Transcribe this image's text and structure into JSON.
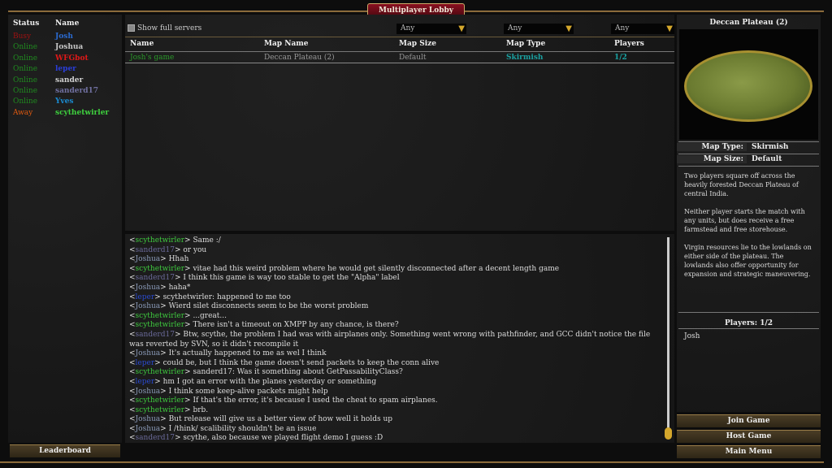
{
  "title": "Multiplayer Lobby",
  "colors": {
    "accent_gold": "#b08a50",
    "busy": "#a01010",
    "online": "#1f8a1f",
    "away": "#e05a10"
  },
  "users": {
    "headers": {
      "status": "Status",
      "name": "Name"
    },
    "items": [
      {
        "status": "Busy",
        "status_color": "#a01010",
        "name": "Josh",
        "name_color": "#2a6ad0"
      },
      {
        "status": "Online",
        "status_color": "#1f8a1f",
        "name": "Joshua",
        "name_color": "#c8c8c8"
      },
      {
        "status": "Online",
        "status_color": "#1f8a1f",
        "name": "WFGbot",
        "name_color": "#e01818"
      },
      {
        "status": "Online",
        "status_color": "#1f8a1f",
        "name": "leper",
        "name_color": "#2a3ed8"
      },
      {
        "status": "Online",
        "status_color": "#1f8a1f",
        "name": "sander",
        "name_color": "#d0d0d0"
      },
      {
        "status": "Online",
        "status_color": "#1f8a1f",
        "name": "sanderd17",
        "name_color": "#7070a0"
      },
      {
        "status": "Online",
        "status_color": "#1f8a1f",
        "name": "Yves",
        "name_color": "#1a8ad0"
      },
      {
        "status": "Away",
        "status_color": "#e05a10",
        "name": "scythetwirler",
        "name_color": "#3ed03e"
      }
    ],
    "leaderboard_label": "Leaderboard"
  },
  "filters": {
    "show_full_label": "Show full servers",
    "show_full_checked": false,
    "map_size": "Any",
    "map_type": "Any",
    "players": "Any"
  },
  "games": {
    "columns": [
      "Name",
      "Map Name",
      "Map Size",
      "Map Type",
      "Players"
    ],
    "rows": [
      {
        "name": "Josh's game",
        "map": "Deccan Plateau (2)",
        "size": "Default",
        "type": "Skirmish",
        "players": "1/2"
      }
    ]
  },
  "chat": [
    {
      "u": "scythetwirler",
      "c": "#3ec93e",
      "m": "Same :/"
    },
    {
      "u": "sanderd17",
      "c": "#6a6a9a",
      "m": "or you"
    },
    {
      "u": "Joshua",
      "c": "#8a9ab8",
      "m": "Hhah"
    },
    {
      "u": "scythetwirler",
      "c": "#3ec93e",
      "m": "vitae had this weird problem where he would get silently disconnected after a decent length game"
    },
    {
      "u": "sanderd17",
      "c": "#6a6a9a",
      "m": "I think this game is way too stable to get the \"Alpha\" label"
    },
    {
      "u": "Joshua",
      "c": "#8a9ab8",
      "m": "haha*"
    },
    {
      "u": "leper",
      "c": "#2a4ad0",
      "m": "scythetwirler: happened to me too"
    },
    {
      "u": "Joshua",
      "c": "#8a9ab8",
      "m": "Wierd silet disconnects seem to be the worst problem"
    },
    {
      "u": "scythetwirler",
      "c": "#3ec93e",
      "m": "...great..."
    },
    {
      "u": "scythetwirler",
      "c": "#3ec93e",
      "m": "There isn't a timeout on XMPP by any chance, is there?"
    },
    {
      "u": "sanderd17",
      "c": "#6a6a9a",
      "m": "Btw, scythe, the problem I had was with airplanes only. Something went wrong with pathfinder, and GCC didn't notice the file was reverted by SVN, so it didn't recompile it"
    },
    {
      "u": "Joshua",
      "c": "#8a9ab8",
      "m": "It's actually happened to me as wel I think"
    },
    {
      "u": "leper",
      "c": "#2a4ad0",
      "m": "could be, but I think the game doesn't send packets to keep the conn alive"
    },
    {
      "u": "scythetwirler",
      "c": "#3ec93e",
      "m": "sanderd17: Was it something about GetPassabilityClass?"
    },
    {
      "u": "leper",
      "c": "#2a4ad0",
      "m": "hm I got an error with the planes yesterday or something"
    },
    {
      "u": "Joshua",
      "c": "#8a9ab8",
      "m": "I think some keep-alive packets might help"
    },
    {
      "u": "scythetwirler",
      "c": "#3ec93e",
      "m": "If that's the error, it's because I used the cheat to spam airplanes."
    },
    {
      "u": "scythetwirler",
      "c": "#3ec93e",
      "m": "brb."
    },
    {
      "u": "Joshua",
      "c": "#8a9ab8",
      "m": "But release will give us a better view of how well it holds up"
    },
    {
      "u": "Joshua",
      "c": "#8a9ab8",
      "m": "I /think/ scalibility shouldn't be an issue"
    },
    {
      "u": "sanderd17",
      "c": "#6a6a9a",
      "m": "scythe, also because we played flight demo I guess :D"
    }
  ],
  "details": {
    "map_name": "Deccan Plateau (2)",
    "map_type_label": "Map Type:",
    "map_type": "Skirmish",
    "map_size_label": "Map Size:",
    "map_size": "Default",
    "description": [
      "Two players square off across the heavily forested Deccan Plateau of central India.",
      "Neither player starts the match with any units, but does receive a free farmstead and free storehouse.",
      "Virgin resources lie to the lowlands on either side of the plateau. The lowlands also offer opportunity for expansion and strategic maneuvering."
    ],
    "players_label": "Players: 1/2",
    "players": [
      "Josh"
    ]
  },
  "buttons": {
    "join": "Join Game",
    "host": "Host Game",
    "main_menu": "Main Menu"
  }
}
